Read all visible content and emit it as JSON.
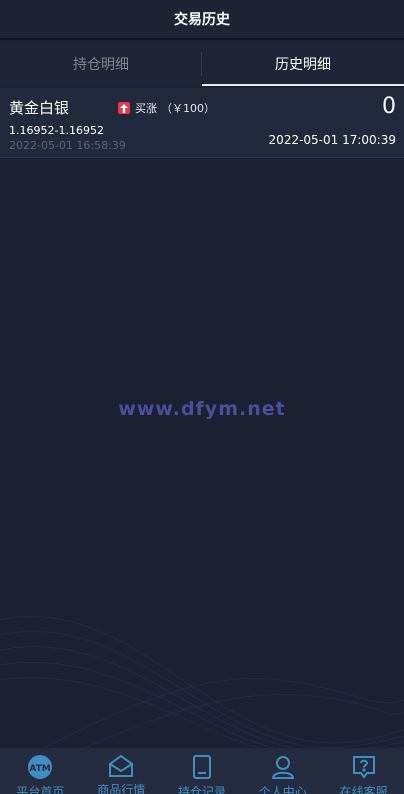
{
  "header": {
    "title": "交易历史"
  },
  "tabs": [
    {
      "label": "持仓明细",
      "active": false
    },
    {
      "label": "历史明细",
      "active": true
    }
  ],
  "records": [
    {
      "name": "黄金白银",
      "direction": "买涨",
      "amount": "（￥100）",
      "result": "0",
      "price_range": "1.16952-1.16952",
      "open_time": "2022-05-01 16:58:39",
      "close_time": "2022-05-01 17:00:39"
    }
  ],
  "watermark": "www.dfym.net",
  "nav": [
    {
      "label": "平台首页",
      "icon": "platform-logo-icon"
    },
    {
      "label": "商品行情",
      "icon": "envelope-icon"
    },
    {
      "label": "持仓记录",
      "icon": "book-icon"
    },
    {
      "label": "个人中心",
      "icon": "user-icon"
    },
    {
      "label": "在线客服",
      "icon": "help-chat-icon"
    }
  ],
  "colors": {
    "accent": "#3f8fc4",
    "up": "#e23a4b",
    "background": "#1b2032"
  }
}
